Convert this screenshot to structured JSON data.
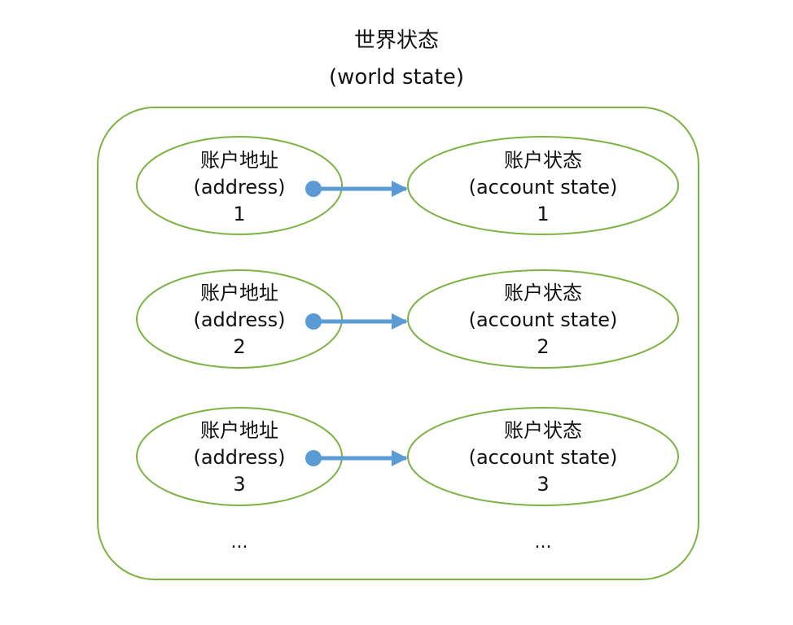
{
  "title": {
    "zh": "世界状态",
    "en": "(world state)"
  },
  "colors": {
    "outline": "#7cb342",
    "arrow": "#5b9bd5",
    "text": "#111111"
  },
  "rows": [
    {
      "address": {
        "zh": "账户地址",
        "en": "(address)",
        "num": "1"
      },
      "state": {
        "zh": "账户状态",
        "en": "(account state)",
        "num": "1"
      }
    },
    {
      "address": {
        "zh": "账户地址",
        "en": "(address)",
        "num": "2"
      },
      "state": {
        "zh": "账户状态",
        "en": "(account state)",
        "num": "2"
      }
    },
    {
      "address": {
        "zh": "账户地址",
        "en": "(address)",
        "num": "3"
      },
      "state": {
        "zh": "账户状态",
        "en": "(account state)",
        "num": "3"
      }
    }
  ],
  "ellipsis": {
    "left": "...",
    "right": "..."
  }
}
